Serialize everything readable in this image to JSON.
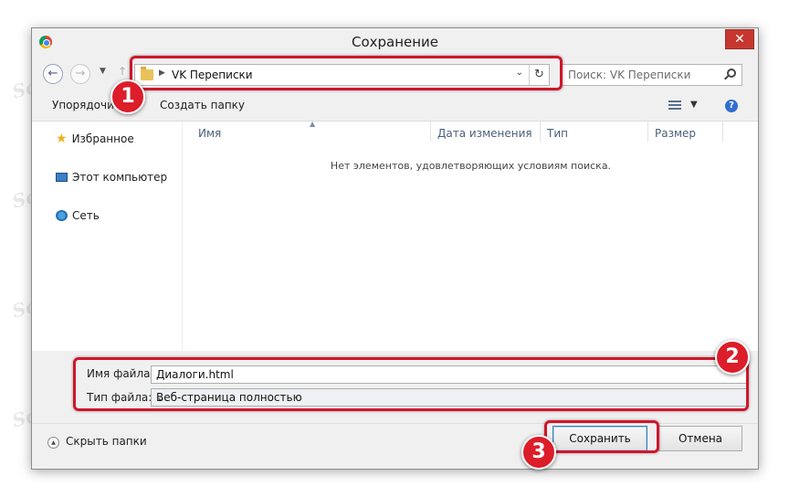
{
  "window": {
    "title": "Сохранение",
    "close_glyph": "✕"
  },
  "navbar": {
    "back_glyph": "←",
    "forward_glyph": "→",
    "dropdown_glyph": "▼",
    "up_glyph": "↑",
    "address_arrow": "▶",
    "address_path": "VK Переписки",
    "address_dropdown_glyph": "⌄",
    "refresh_glyph": "↻",
    "search_placeholder": "Поиск: VK Переписки"
  },
  "toolbar": {
    "organize_label": "Упорядочить",
    "new_folder_label": "Создать папку",
    "view_dropdown_glyph": "▼",
    "help_glyph": "?"
  },
  "sidebar": {
    "items": [
      {
        "label": "Избранное",
        "icon": "star-icon"
      },
      {
        "label": "Этот компьютер",
        "icon": "computer-icon"
      },
      {
        "label": "Сеть",
        "icon": "network-icon"
      }
    ]
  },
  "file_list": {
    "columns": [
      "Имя",
      "Дата изменения",
      "Тип",
      "Размер"
    ],
    "sort_glyph": "▲",
    "empty_message": "Нет элементов, удовлетворяющих условиям поиска."
  },
  "form": {
    "filename_label": "Имя файла:",
    "filename_value": "Диалоги.html",
    "filetype_label": "Тип файла:",
    "filetype_value": "Веб-страница полностью",
    "combo_glyph": "⌄"
  },
  "footer": {
    "hide_folders_label": "Скрыть папки",
    "hide_glyph": "▲",
    "save_label": "Сохранить",
    "cancel_label": "Отмена"
  },
  "annotations": {
    "badge1": "1",
    "badge2": "2",
    "badge3": "3",
    "highlight_color": "#d0162a"
  },
  "watermark": "Soringpcrepair.Com"
}
